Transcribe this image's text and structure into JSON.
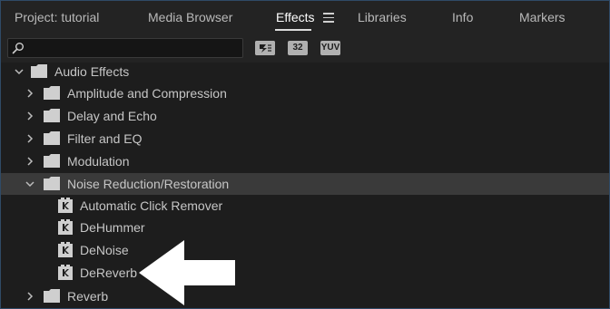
{
  "tabs": [
    {
      "label": "Project: tutorial"
    },
    {
      "label": "Media Browser"
    },
    {
      "label": "Effects",
      "active": true
    },
    {
      "label": "Libraries"
    },
    {
      "label": "Info"
    },
    {
      "label": "Markers"
    }
  ],
  "search": {
    "value": "",
    "placeholder": ""
  },
  "filters": [
    "32",
    "YUV"
  ],
  "tree": [
    {
      "label": "Audio Effects",
      "type": "folder",
      "expanded": true
    },
    {
      "label": "Amplitude and Compression",
      "type": "folder",
      "expanded": false
    },
    {
      "label": "Delay and Echo",
      "type": "folder",
      "expanded": false
    },
    {
      "label": "Filter and EQ",
      "type": "folder",
      "expanded": false
    },
    {
      "label": "Modulation",
      "type": "folder",
      "expanded": false
    },
    {
      "label": "Noise Reduction/Restoration",
      "type": "folder",
      "expanded": true,
      "selected": true
    },
    {
      "label": "Automatic Click Remover",
      "type": "effect"
    },
    {
      "label": "DeHummer",
      "type": "effect"
    },
    {
      "label": "DeNoise",
      "type": "effect"
    },
    {
      "label": "DeReverb",
      "type": "effect"
    },
    {
      "label": "Reverb",
      "type": "folder",
      "expanded": false
    }
  ],
  "colors": {
    "background": "#1d1d1d",
    "selected_row": "#3a3a3a",
    "active_tab_underline": "#dcdcdc",
    "annotation_arrow": "#ffffff"
  },
  "icons": {
    "menu": "hamburger-menu-icon",
    "search": "magnifier-icon",
    "folder": "folder-icon",
    "effect": "audio-effect-icon",
    "expanded": "chevron-down-icon",
    "collapsed": "chevron-right-icon",
    "annotation": "left-pointing-arrow"
  }
}
